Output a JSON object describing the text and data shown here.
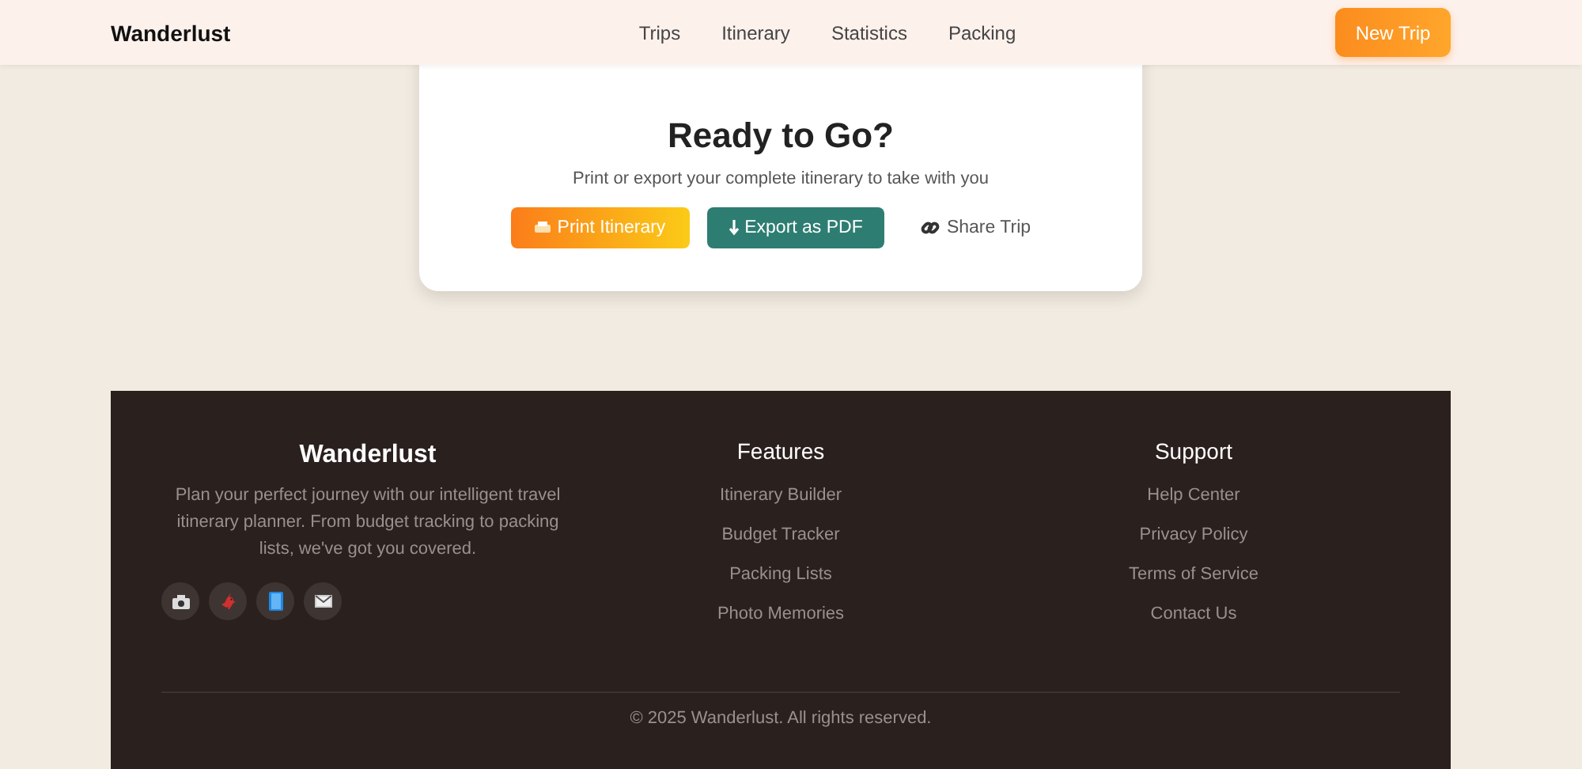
{
  "header": {
    "logo": "Wanderlust",
    "nav": [
      {
        "label": "Trips"
      },
      {
        "label": "Itinerary"
      },
      {
        "label": "Statistics"
      },
      {
        "label": "Packing"
      }
    ],
    "action": "New Trip"
  },
  "cta": {
    "title": "Ready to Go?",
    "subtitle": "Print or export your complete itinerary to take with you",
    "buttons": [
      {
        "kind": "print",
        "label": "Print Itinerary"
      },
      {
        "kind": "export",
        "label": "Export as PDF"
      },
      {
        "kind": "share",
        "label": "Share Trip"
      }
    ]
  },
  "footer": {
    "brand": "Wanderlust",
    "about": "Plan your perfect journey with our intelligent travel itinerary planner. From budget tracking to packing lists, we've got you covered.",
    "socials": [
      {
        "kind": "camera"
      },
      {
        "kind": "bird"
      },
      {
        "kind": "book"
      },
      {
        "kind": "mail"
      }
    ],
    "columns": [
      {
        "title": "Features",
        "links": [
          "Itinerary Builder",
          "Budget Tracker",
          "Packing Lists",
          "Photo Memories"
        ]
      },
      {
        "title": "Support",
        "links": [
          "Help Center",
          "Privacy Policy",
          "Terms of Service",
          "Contact Us"
        ]
      }
    ],
    "copyright": "© 2025 Wanderlust. All rights reserved."
  }
}
